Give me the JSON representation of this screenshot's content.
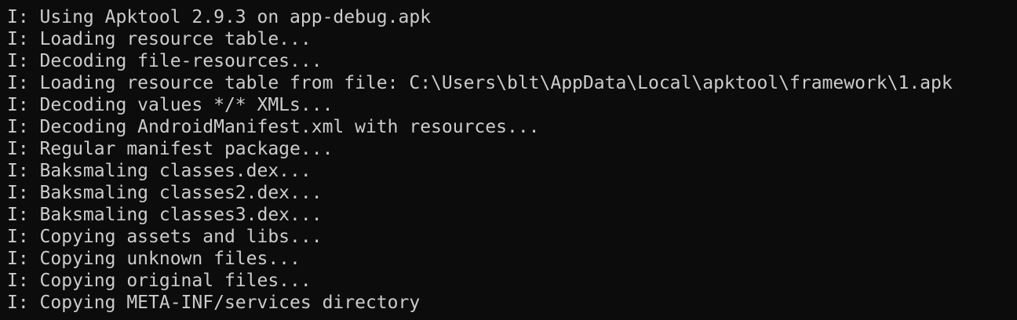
{
  "terminal": {
    "colors": {
      "background": "#0c0c0c",
      "foreground": "#cccccc"
    },
    "lines": [
      "I: Using Apktool 2.9.3 on app-debug.apk",
      "I: Loading resource table...",
      "I: Decoding file-resources...",
      "I: Loading resource table from file: C:\\Users\\blt\\AppData\\Local\\apktool\\framework\\1.apk",
      "I: Decoding values */* XMLs...",
      "I: Decoding AndroidManifest.xml with resources...",
      "I: Regular manifest package...",
      "I: Baksmaling classes.dex...",
      "I: Baksmaling classes2.dex...",
      "I: Baksmaling classes3.dex...",
      "I: Copying assets and libs...",
      "I: Copying unknown files...",
      "I: Copying original files...",
      "I: Copying META-INF/services directory"
    ]
  }
}
